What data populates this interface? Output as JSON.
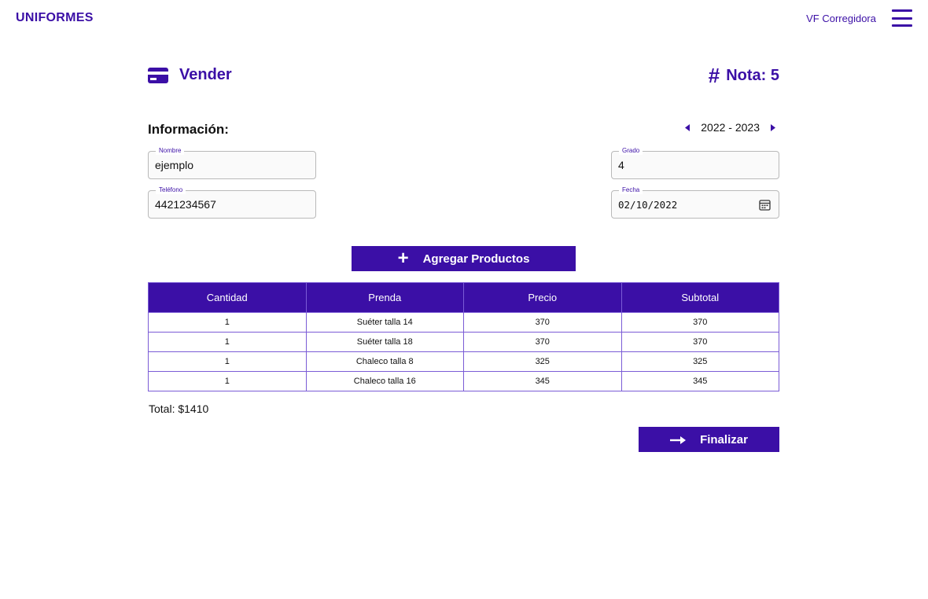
{
  "header": {
    "brand": "UNIFORMES",
    "user": "VF Corregidora",
    "menu_icon": "hamburger-menu-icon"
  },
  "page": {
    "title": "Vender",
    "title_icon": "credit-card-icon",
    "nota_label": "Nota: 5",
    "nota_icon": "hash-icon"
  },
  "info": {
    "label": "Información:",
    "year_range": "2022 - 2023"
  },
  "form": {
    "nombre": {
      "label": "Nombre",
      "value": "ejemplo"
    },
    "telefono": {
      "label": "Teléfono",
      "value": "4421234567"
    },
    "grado": {
      "label": "Grado",
      "value": "4"
    },
    "fecha": {
      "label": "Fecha",
      "value": "02/10/2022"
    }
  },
  "add_button": {
    "label": "Agregar Productos",
    "icon": "plus-icon"
  },
  "table": {
    "headers": [
      "Cantidad",
      "Prenda",
      "Precio",
      "Subtotal"
    ],
    "rows": [
      [
        "1",
        "Suéter talla 14",
        "370",
        "370"
      ],
      [
        "1",
        "Suéter talla 18",
        "370",
        "370"
      ],
      [
        "1",
        "Chaleco talla 8",
        "325",
        "325"
      ],
      [
        "1",
        "Chaleco talla 16",
        "345",
        "345"
      ]
    ]
  },
  "total": "Total: $1410",
  "finish_button": {
    "label": "Finalizar",
    "icon": "arrow-right-icon"
  },
  "colors": {
    "accent": "#3b0fa6",
    "border": "#7b5cd6"
  }
}
